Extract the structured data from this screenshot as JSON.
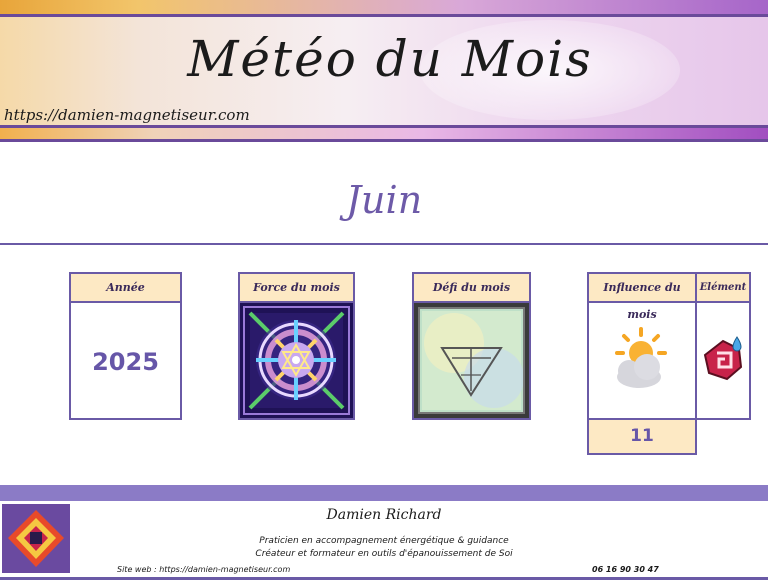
{
  "banner": {
    "title": "Météo du Mois",
    "url": "https://damien-magnetiseur.com"
  },
  "month": "Juin",
  "cards": {
    "year": {
      "header": "Année",
      "value": "2025"
    },
    "force": {
      "header": "Force du mois",
      "image": "mandala-star-card"
    },
    "defi": {
      "header": "Défi du mois",
      "image": "triangle-symbol-card"
    },
    "influence": {
      "header": "Influence du mois",
      "icon": "sun-behind-cloud-icon",
      "value": "11"
    },
    "element": {
      "header": "Elément",
      "icon": "water-element-spiral-icon"
    }
  },
  "footer": {
    "author": "Damien Richard",
    "line1": "Praticien en accompagnement énergétique & guidance",
    "line2": "Créateur et formateur en outils d'épanouissement de Soi",
    "site": "Site web : https://damien-magnetiseur.com",
    "phone": "06 16 90 30 47"
  },
  "colors": {
    "accent": "#6a5aa6",
    "header_bg": "#fde9c4",
    "value": "#6656a8"
  }
}
